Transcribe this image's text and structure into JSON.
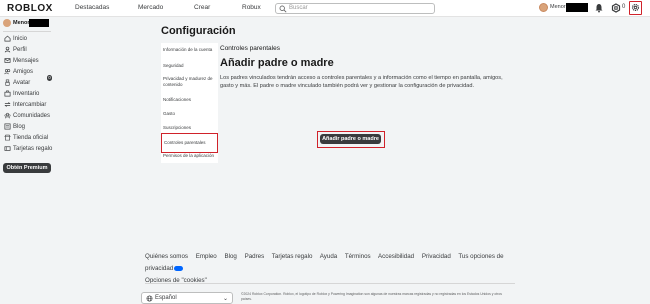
{
  "topbar": {
    "logo": "ROBLOX",
    "nav": [
      "Destacadas",
      "Mercado",
      "Crear",
      "Robux"
    ],
    "search_placeholder": "Buscar",
    "username": "Menor",
    "robux": "0"
  },
  "sidebar": {
    "username": "Menor",
    "items": [
      {
        "label": "Inicio",
        "icon": "home-icon"
      },
      {
        "label": "Perfil",
        "icon": "profile-icon"
      },
      {
        "label": "Mensajes",
        "icon": "messages-icon",
        "badge": "0"
      },
      {
        "label": "Amigos",
        "icon": "friends-icon"
      },
      {
        "label": "Avatar",
        "icon": "avatar-icon"
      },
      {
        "label": "Inventario",
        "icon": "inventory-icon"
      },
      {
        "label": "Intercambiar",
        "icon": "trade-icon"
      },
      {
        "label": "Comunidades",
        "icon": "communities-icon"
      },
      {
        "label": "Blog",
        "icon": "blog-icon"
      },
      {
        "label": "Tienda oficial",
        "icon": "store-icon"
      },
      {
        "label": "Tarjetas regalo",
        "icon": "gift-card-icon"
      }
    ],
    "premium_label": "Obtén Premium"
  },
  "settings": {
    "title": "Configuración",
    "nav": [
      "Información de la cuenta",
      "Seguridad",
      "Privacidad y madurez de contenido",
      "Notificaciones",
      "Gasto",
      "Suscripciones",
      "Controles parentales",
      "Permisos de la aplicación"
    ],
    "active_index": 6,
    "section_title": "Controles parentales",
    "heading": "Añadir padre o madre",
    "description": "Los padres vinculados tendrán acceso a controles parentales y a información como el tiempo en pantalla, amigos, gasto y más. El padre o madre vinculado también podrá ver y gestionar la configuración de privacidad.",
    "add_button": "Añadir padre o madre"
  },
  "footer": {
    "links": [
      "Quiénes somos",
      "Empleo",
      "Blog",
      "Padres",
      "Tarjetas regalo",
      "Ayuda",
      "Términos",
      "Accesibilidad",
      "Privacidad",
      "Tus opciones de privacidad",
      "Opciones de \"cookies\""
    ],
    "language": "Español",
    "copyright": "©2024 Roblox Corporation. Roblox, el logotipo de Roblox y Powering Imagination son algunas de nuestras marcas registradas y no registradas en los Estados Unidos y otros países."
  },
  "colors": {
    "accent_red": "#d0222a",
    "button_dark": "#393b3d",
    "toggle_blue": "#0066ff"
  }
}
